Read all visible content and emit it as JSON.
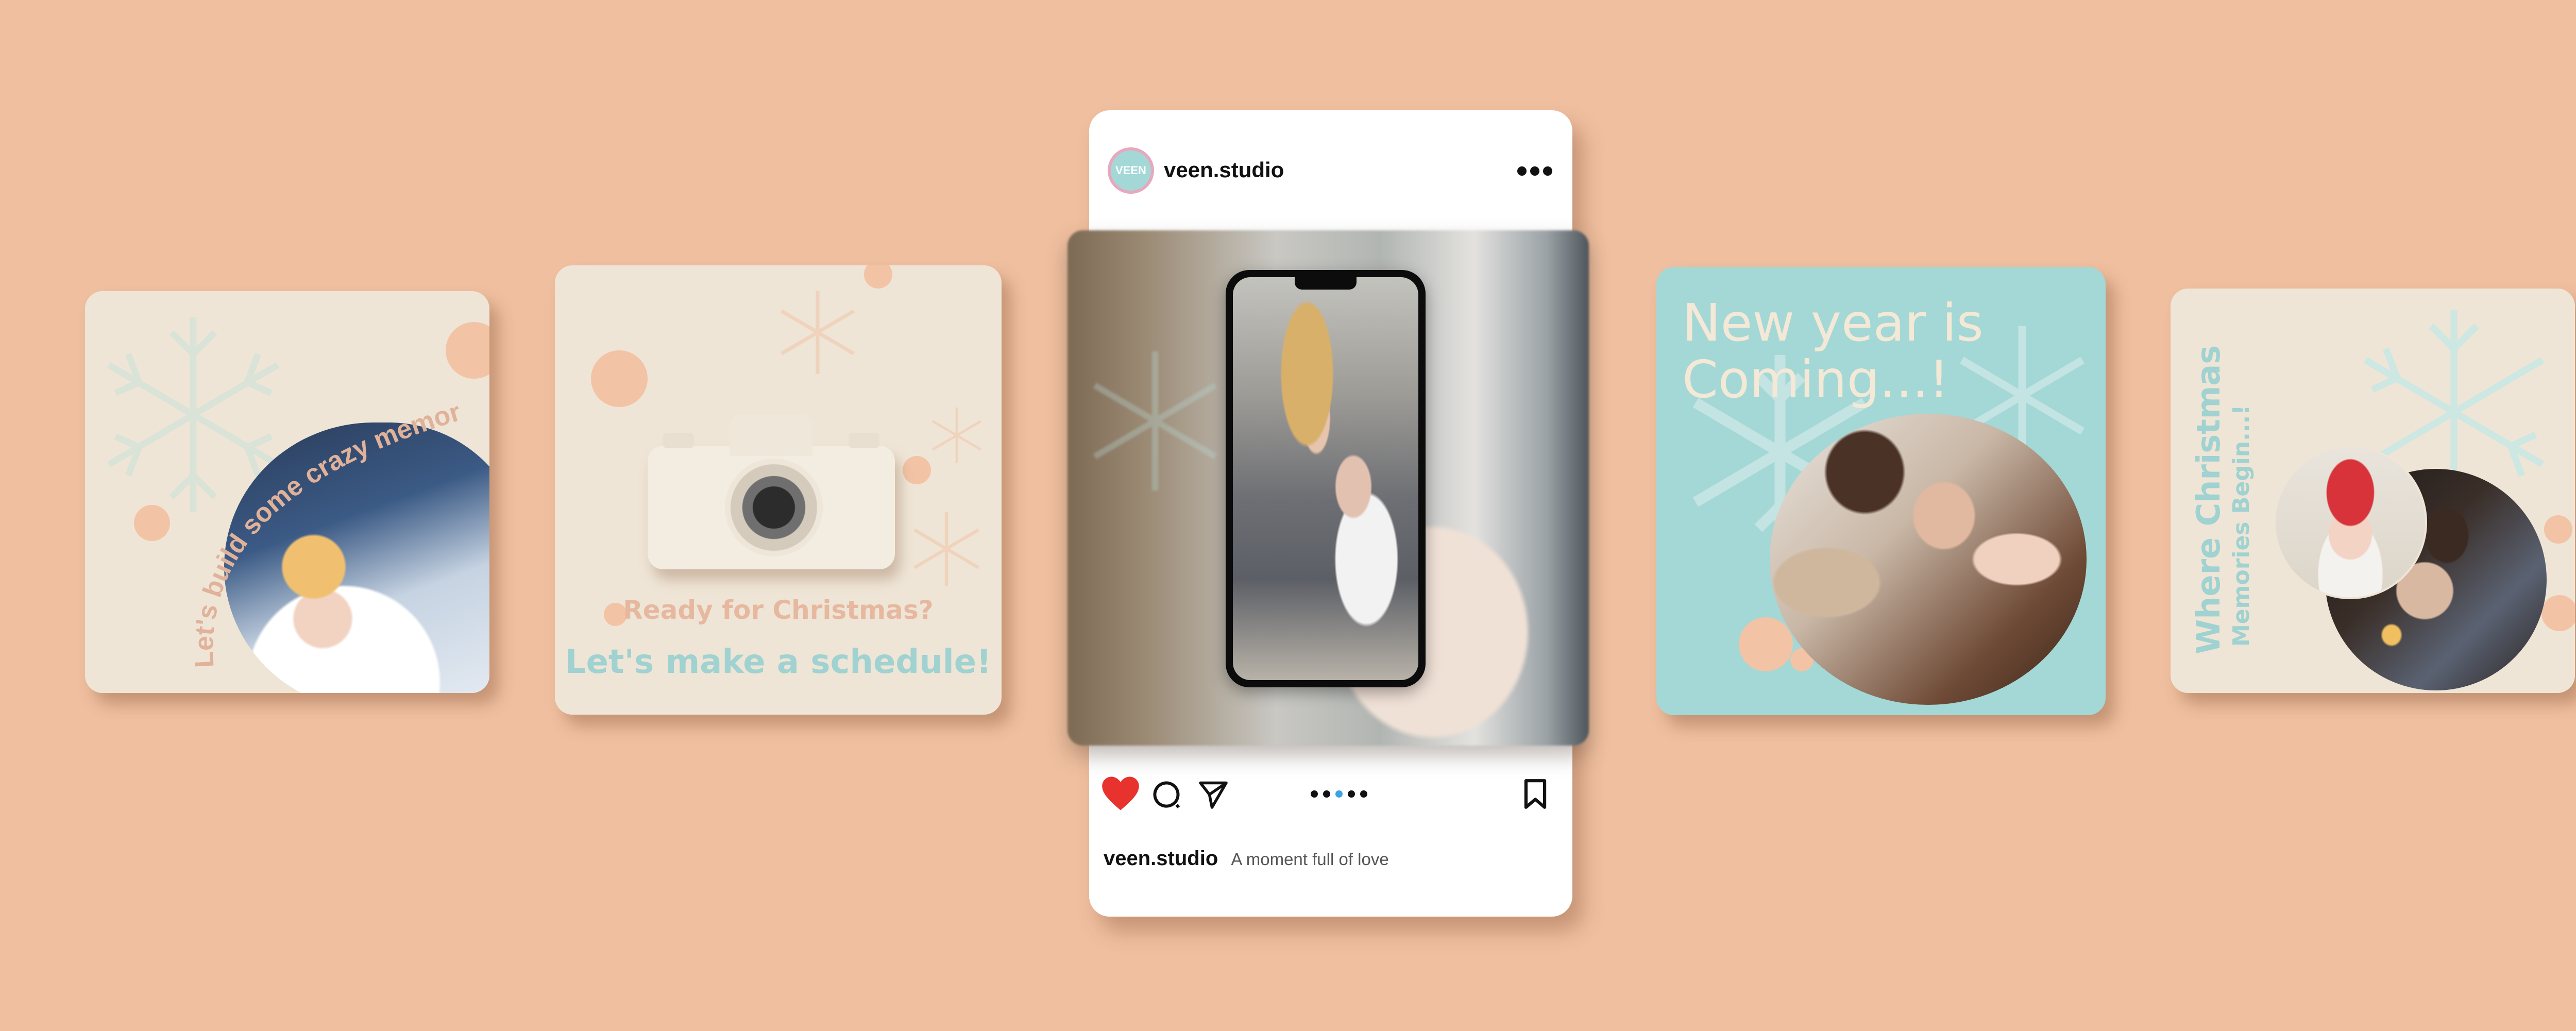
{
  "colors": {
    "background": "#efbf9f",
    "cream": "#efe5d6",
    "teal": "#a3d8d6",
    "peach": "#f2c3a5",
    "text_peach": "#e0b29a",
    "text_teal": "#9fd2d0",
    "like_red": "#e8322e"
  },
  "cards": {
    "card1": {
      "text": "Let's build some crazy memories",
      "photo": "child-in-snow-photo"
    },
    "card2": {
      "line1": "Ready for Christmas?",
      "line2": "Let's make a schedule!",
      "photo": "camera-photo"
    },
    "card4": {
      "title_line1": "New year is",
      "title_line2": "Coming...!",
      "photo": "family-photo"
    },
    "card5": {
      "line1": "Where Christmas",
      "line2": "Memories Begin...!",
      "photo": "newborn-and-couple-photos"
    }
  },
  "post": {
    "username": "veen.studio",
    "avatar_text": "VEEN",
    "caption_user": "veen.studio",
    "caption": "A moment full of love",
    "carousel_dots": 5,
    "active_dot": 3,
    "icons": [
      "heart-icon",
      "comment-icon",
      "share-icon",
      "more-icon",
      "bookmark-icon"
    ]
  }
}
